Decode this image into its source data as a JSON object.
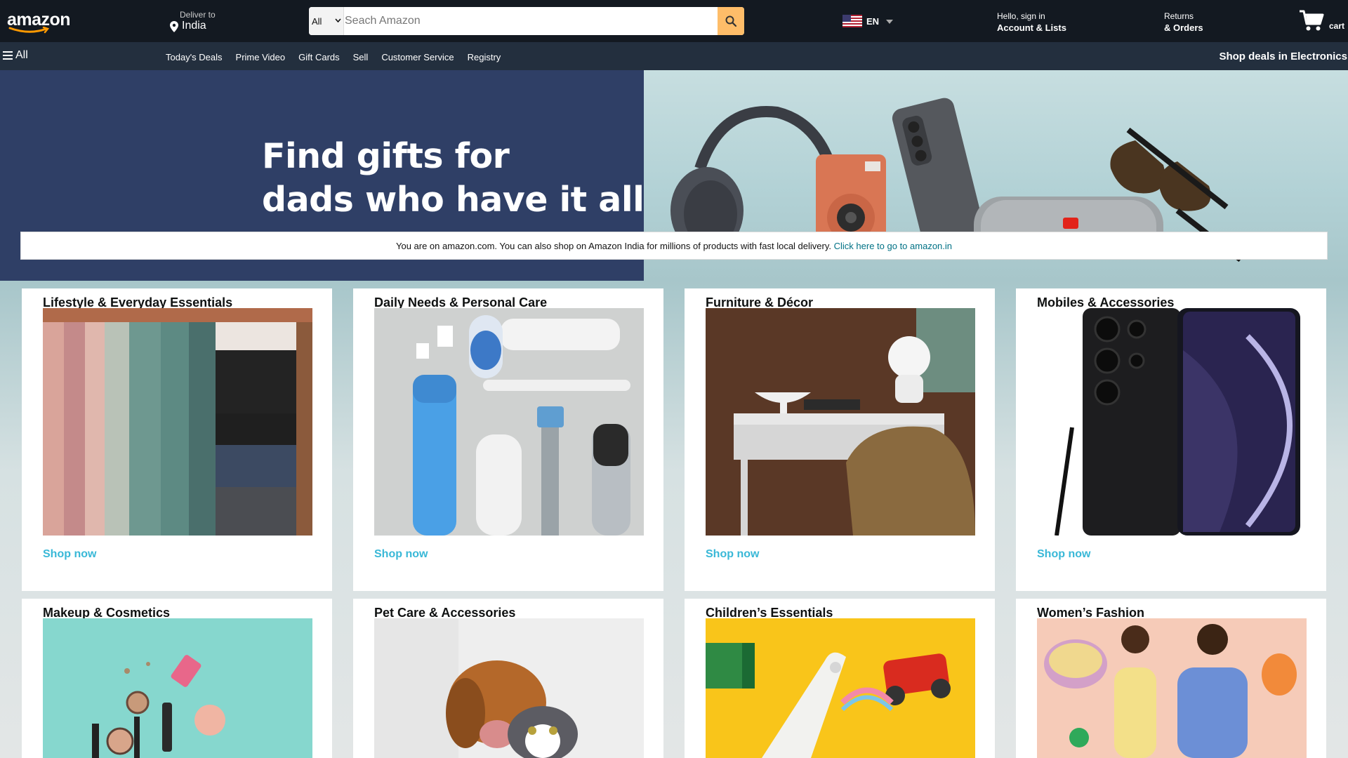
{
  "header": {
    "logo_text": "amazon",
    "deliver_small": "Deliver to",
    "deliver_location": "India",
    "search_category": "All",
    "search_placeholder": "Seach Amazon",
    "language": "EN",
    "account_small": "Hello, sign in",
    "account_big": "Account & Lists",
    "returns_small": "Returns",
    "returns_big": "& Orders",
    "cart_label": "cart"
  },
  "subnav": {
    "all_label": "All",
    "links": [
      "Today's Deals",
      "Prime Video",
      "Gift Cards",
      "Sell",
      "Customer Service",
      "Registry"
    ],
    "promo": "Shop deals in Electronics"
  },
  "hero": {
    "line1": "Find gifts for",
    "line2": "dads who have it all"
  },
  "notice": {
    "text": "You are on amazon.com. You can also shop on Amazon India for millions of products with fast local delivery.",
    "link": "Click here to go to amazon.in"
  },
  "cards": [
    {
      "title": "Lifestyle & Everyday Essentials",
      "cta": "Shop now",
      "image": "scarves-on-hanger"
    },
    {
      "title": "Daily Needs & Personal Care",
      "cta": "Shop now",
      "image": "toiletries-flatlay"
    },
    {
      "title": "Furniture & Décor",
      "cta": "Shop now",
      "image": "desk-and-chair"
    },
    {
      "title": "Mobiles & Accessories",
      "cta": "Shop now",
      "image": "smartphone-with-stylus"
    },
    {
      "title": "Makeup & Cosmetics",
      "cta": "",
      "image": "makeup-flatlay"
    },
    {
      "title": "Pet Care & Accessories",
      "cta": "",
      "image": "dog-and-cat"
    },
    {
      "title": "Children’s Essentials",
      "cta": "",
      "image": "toy-car-and-plane"
    },
    {
      "title": "Women’s Fashion",
      "cta": "",
      "image": "models-in-dresses"
    }
  ],
  "colors": {
    "nav_dark": "#131921",
    "nav_secondary": "#232f3e",
    "search_button": "#febd69",
    "hero_left": "#2f3f66",
    "link_teal": "#007185",
    "shop_now": "#39b8d7"
  }
}
